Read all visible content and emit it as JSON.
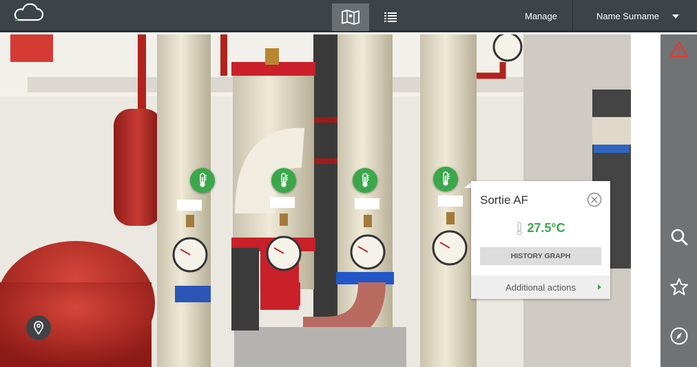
{
  "header": {
    "manage_label": "Manage",
    "user_name": "Name Surname",
    "icons": [
      "cloud-logo-icon",
      "map-view-icon",
      "list-view-icon",
      "chevron-down-icon"
    ]
  },
  "sidebar": {
    "icons": [
      "alert-icon",
      "search-icon",
      "star-icon",
      "compass-icon"
    ],
    "alert_color": "#e53935"
  },
  "sensors": [
    {
      "icon": "thermometer-icon"
    },
    {
      "icon": "thermometer-icon"
    },
    {
      "icon": "thermometer-icon"
    },
    {
      "icon": "thermometer-icon"
    }
  ],
  "popup": {
    "title": "Sortie AF",
    "value": "27.5°C",
    "history_button": "HISTORY GRAPH",
    "additional_actions": "Additional actions"
  },
  "colors": {
    "topbar": "#3d4347",
    "sensor_green": "#3aa84a",
    "sidebar": "#6f7376"
  }
}
